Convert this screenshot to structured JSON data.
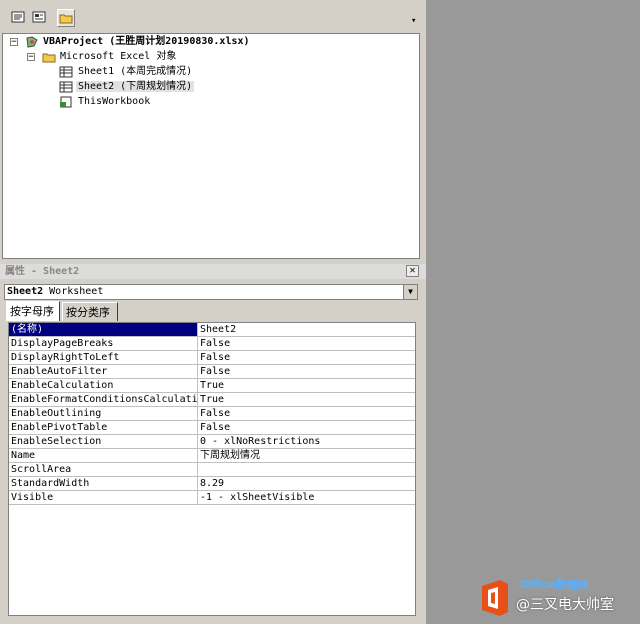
{
  "project_explorer": {
    "project_label": "VBAProject (王胜周计划20190830.xlsx)",
    "folder_label": "Microsoft Excel 对象",
    "items": [
      {
        "label": "Sheet1 (本周完成情况)"
      },
      {
        "label": "Sheet2 (下周规划情况)"
      },
      {
        "label": "ThisWorkbook"
      }
    ]
  },
  "properties": {
    "title": "属性 - Sheet2",
    "close_glyph": "✕",
    "object_name": "Sheet2",
    "object_type": "Worksheet",
    "tabs": [
      "按字母序",
      "按分类序"
    ],
    "rows": [
      {
        "name": "(名称)",
        "value": "Sheet2"
      },
      {
        "name": "DisplayPageBreaks",
        "value": "False"
      },
      {
        "name": "DisplayRightToLeft",
        "value": "False"
      },
      {
        "name": "EnableAutoFilter",
        "value": "False"
      },
      {
        "name": "EnableCalculation",
        "value": "True"
      },
      {
        "name": "EnableFormatConditionsCalculation",
        "value": "True"
      },
      {
        "name": "EnableOutlining",
        "value": "False"
      },
      {
        "name": "EnablePivotTable",
        "value": "False"
      },
      {
        "name": "EnableSelection",
        "value": "0 - xlNoRestrictions"
      },
      {
        "name": "Name",
        "value": "下周规划情况"
      },
      {
        "name": "ScrollArea",
        "value": ""
      },
      {
        "name": "StandardWidth",
        "value": "8.29"
      },
      {
        "name": "Visible",
        "value": "-1 - xlSheetVisible"
      }
    ]
  },
  "watermark": {
    "brand": "Office教程网",
    "text": "@三叉电大帅室"
  },
  "colors": {
    "selection_bg": "#000080",
    "panel_bg": "#d4d0c8",
    "workspace_bg": "#999999",
    "watermark_orange": "#e8501a"
  }
}
